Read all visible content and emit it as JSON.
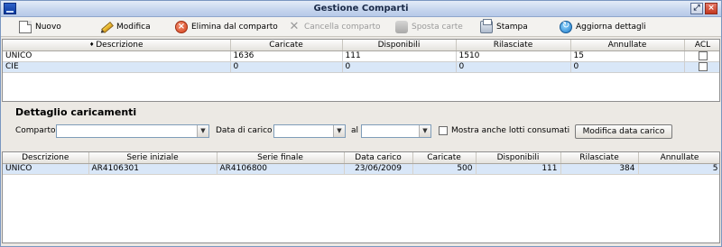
{
  "window": {
    "title": "Gestione Comparti"
  },
  "toolbar": {
    "new": "Nuovo",
    "edit": "Modifica",
    "remove": "Elimina dal comparto",
    "delete_compartment": "Cancella comparto",
    "move_cards": "Sposta carte",
    "print": "Stampa",
    "refresh_details": "Aggiorna dettagli"
  },
  "compartments_grid": {
    "columns": [
      "Descrizione",
      "Caricate",
      "Disponibili",
      "Rilasciate",
      "Annullate",
      "ACL"
    ],
    "rows": [
      {
        "descrizione": "UNICO",
        "caricate": "1636",
        "disponibili": "111",
        "rilasciate": "1510",
        "annullate": "15",
        "acl": false
      },
      {
        "descrizione": "CIE",
        "caricate": "0",
        "disponibili": "0",
        "rilasciate": "0",
        "annullate": "0",
        "acl": false
      }
    ]
  },
  "detail": {
    "title": "Dettaglio caricamenti",
    "comparto_label": "Comparto",
    "comparto_value": "",
    "date_from_label": "Data di carico dal",
    "date_from_value": "",
    "date_to_label": "al",
    "date_to_value": "",
    "show_consumed_label": "Mostra anche lotti consumati",
    "show_consumed_checked": false,
    "edit_date_button": "Modifica data carico"
  },
  "loads_grid": {
    "columns": [
      "Descrizione",
      "Serie iniziale",
      "Serie finale",
      "Data carico",
      "Caricate",
      "Disponibili",
      "Rilasciate",
      "Annullate"
    ],
    "rows": [
      {
        "descrizione": "UNICO",
        "serie_iniziale": "AR4106301",
        "serie_finale": "AR4106800",
        "data_carico": "23/06/2009",
        "caricate": "500",
        "disponibili": "111",
        "rilasciate": "384",
        "annullate": "5"
      }
    ]
  },
  "colors": {
    "selected_row": "#d9e7f8",
    "title_bar": "#c7d6ee",
    "close_button": "#c2361e"
  }
}
